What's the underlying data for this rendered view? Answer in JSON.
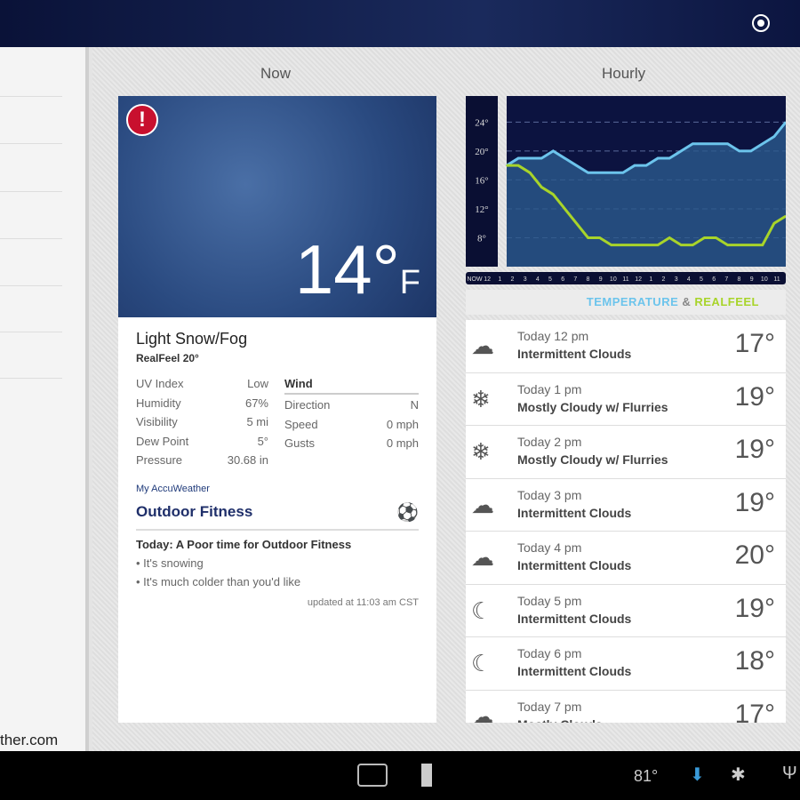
{
  "topbar": {
    "location_icon": "locate-icon"
  },
  "left": {
    "site": "ther.com"
  },
  "headers": {
    "now": "Now",
    "hourly": "Hourly"
  },
  "now": {
    "temp": "14°",
    "unit": "F",
    "condition": "Light Snow/Fog",
    "realfeel": "RealFeel 20°",
    "stats": [
      {
        "k": "UV Index",
        "v": "Low"
      },
      {
        "k": "Humidity",
        "v": "67%"
      },
      {
        "k": "Visibility",
        "v": "5 mi"
      },
      {
        "k": "Dew Point",
        "v": "5°"
      },
      {
        "k": "Pressure",
        "v": "30.68 in"
      }
    ],
    "wind_title": "Wind",
    "wind": [
      {
        "k": "Direction",
        "v": "N"
      },
      {
        "k": "Speed",
        "v": "0 mph"
      },
      {
        "k": "Gusts",
        "v": "0 mph"
      }
    ],
    "my_accuweather": "My AccuWeather",
    "fitness_title": "Outdoor Fitness",
    "fitness_summary": "Today: A Poor time for Outdoor Fitness",
    "bullets": [
      "• It's snowing",
      "• It's much colder than you'd like"
    ],
    "updated": "updated at 11:03 am CST"
  },
  "legend": {
    "temp": "TEMPERATURE",
    "amp": " & ",
    "realfeel": "REALFEEL"
  },
  "chart_data": {
    "type": "line",
    "x": [
      "NOW",
      "12",
      "1",
      "2",
      "3",
      "4",
      "5",
      "6",
      "7",
      "8",
      "9",
      "10",
      "11",
      "12",
      "1",
      "2",
      "3",
      "4",
      "5",
      "6",
      "7",
      "8",
      "9",
      "10",
      "11"
    ],
    "yticks": [
      "24°",
      "20°",
      "16°",
      "12°",
      "8°"
    ],
    "ylim": [
      4,
      27
    ],
    "series": [
      {
        "name": "Temperature",
        "color": "#6cc4ec",
        "values": [
          18,
          19,
          19,
          19,
          20,
          19,
          18,
          17,
          17,
          17,
          17,
          18,
          18,
          19,
          19,
          20,
          21,
          21,
          21,
          21,
          20,
          20,
          21,
          22,
          24
        ]
      },
      {
        "name": "RealFeel",
        "color": "#a8d42a",
        "values": [
          18,
          18,
          17,
          15,
          14,
          12,
          10,
          8,
          8,
          7,
          7,
          7,
          7,
          7,
          8,
          7,
          7,
          8,
          8,
          7,
          7,
          7,
          7,
          10,
          11
        ]
      }
    ]
  },
  "hourly": [
    {
      "time": "Today 12 pm",
      "desc": "Intermittent Clouds",
      "temp": "17°",
      "icon": "☁"
    },
    {
      "time": "Today 1 pm",
      "desc": "Mostly Cloudy w/ Flurries",
      "temp": "19°",
      "icon": "❄"
    },
    {
      "time": "Today 2 pm",
      "desc": "Mostly Cloudy w/ Flurries",
      "temp": "19°",
      "icon": "❄"
    },
    {
      "time": "Today 3 pm",
      "desc": "Intermittent Clouds",
      "temp": "19°",
      "icon": "☁"
    },
    {
      "time": "Today 4 pm",
      "desc": "Intermittent Clouds",
      "temp": "20°",
      "icon": "☁"
    },
    {
      "time": "Today 5 pm",
      "desc": "Intermittent Clouds",
      "temp": "19°",
      "icon": "☾"
    },
    {
      "time": "Today 6 pm",
      "desc": "Intermittent Clouds",
      "temp": "18°",
      "icon": "☾"
    },
    {
      "time": "Today 7 pm",
      "desc": "Mostly Clouds",
      "temp": "17°",
      "icon": "☁"
    }
  ],
  "status": {
    "temp": "81°"
  }
}
